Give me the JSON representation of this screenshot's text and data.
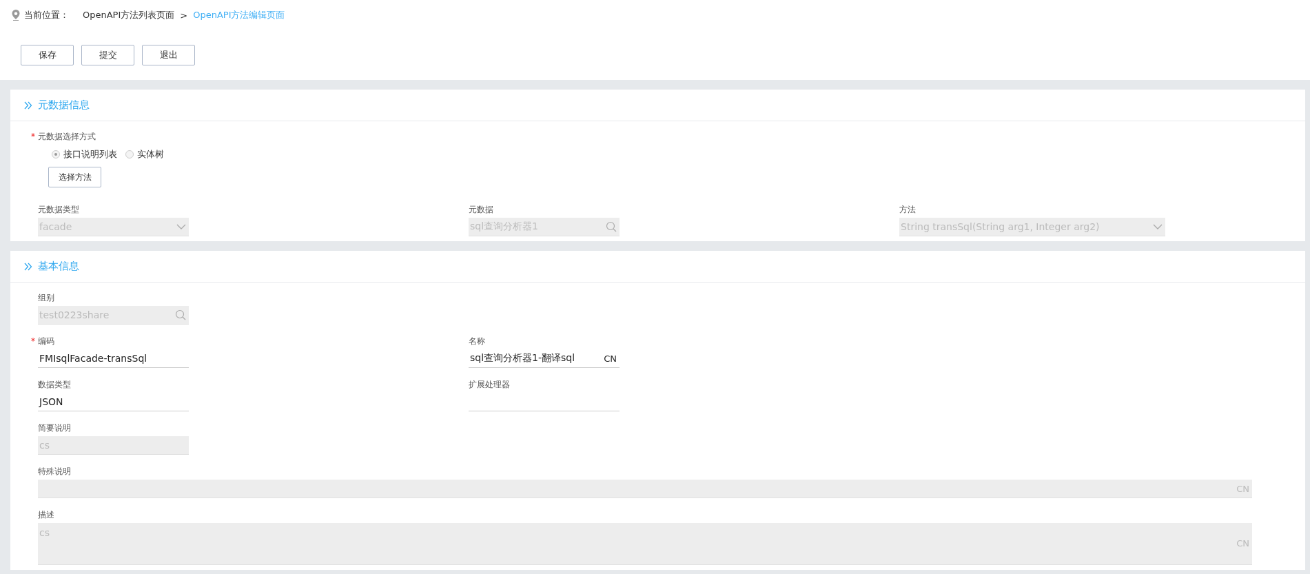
{
  "breadcrumb": {
    "label": "当前位置：",
    "items": [
      {
        "text": "OpenAPI方法列表页面",
        "selected": false
      },
      {
        "text": "OpenAPI方法编辑页面",
        "selected": true
      }
    ],
    "separator": ">"
  },
  "toolbar": [
    "保存",
    "提交",
    "退出"
  ],
  "sections": [
    {
      "title": "元数据信息",
      "choice": {
        "label": "元数据选择方式",
        "required_mark": "*",
        "options": [
          {
            "label": "接口说明列表",
            "selected": true
          },
          {
            "label": "实体树",
            "selected": false
          }
        ],
        "button": "选择方法"
      },
      "rows": [
        [
          {
            "kind": "select",
            "label": "元数据类型",
            "value": "facade",
            "disabled": true
          },
          {
            "kind": "lookup",
            "label": "元数据",
            "value": "sql查询分析器1",
            "disabled": true
          },
          {
            "kind": "select",
            "label": "方法",
            "value": "String transSql(String arg1, Integer arg2)",
            "disabled": true
          }
        ]
      ]
    },
    {
      "title": "基本信息",
      "rows": [
        [
          {
            "kind": "lookup",
            "label": "组别",
            "value": "test0223share",
            "disabled": true
          }
        ],
        [
          {
            "kind": "text",
            "label": "编码",
            "value": "FMIsqlFacade-transSql",
            "required_mark": "*",
            "disabled": false
          },
          {
            "kind": "text",
            "label": "名称",
            "value": "sql查询分析器1-翻译sql",
            "suffix": "CN",
            "disabled": false
          }
        ],
        [
          {
            "kind": "text",
            "label": "数据类型",
            "value": "JSON",
            "disabled": false
          },
          {
            "kind": "text",
            "label": "扩展处理器",
            "disabled": false
          }
        ],
        [
          {
            "kind": "text",
            "label": "简要说明",
            "value": "cs",
            "disabled": true
          }
        ],
        [
          {
            "kind": "longtext",
            "label": "特殊说明",
            "suffix": "CN",
            "disabled": true
          }
        ],
        [
          {
            "kind": "textarea",
            "label": "描述",
            "value": "cs",
            "suffix": "CN",
            "disabled": true
          }
        ]
      ]
    }
  ]
}
